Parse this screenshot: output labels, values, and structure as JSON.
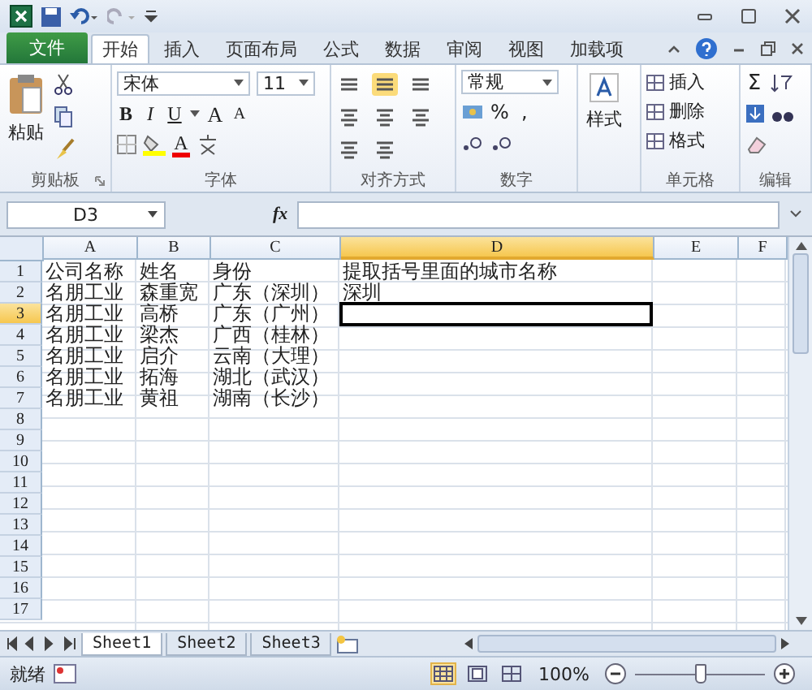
{
  "ribbon_tabs": [
    {
      "label": "文件",
      "kind": "file",
      "selected": false
    },
    {
      "label": "开始",
      "kind": "tab",
      "selected": true
    },
    {
      "label": "插入",
      "kind": "tab",
      "selected": false
    },
    {
      "label": "页面布局",
      "kind": "tab",
      "selected": false
    },
    {
      "label": "公式",
      "kind": "tab",
      "selected": false
    },
    {
      "label": "数据",
      "kind": "tab",
      "selected": false
    },
    {
      "label": "审阅",
      "kind": "tab",
      "selected": false
    },
    {
      "label": "视图",
      "kind": "tab",
      "selected": false
    },
    {
      "label": "加载项",
      "kind": "tab",
      "selected": false
    }
  ],
  "ribbon": {
    "clipboard": {
      "paste": "粘贴",
      "label": "剪贴板"
    },
    "font": {
      "name": "宋体",
      "size": "11",
      "bold": "B",
      "italic": "I",
      "underline": "U",
      "grow": "A",
      "shrink": "A",
      "color_button": "A",
      "label": "字体"
    },
    "alignment": {
      "label": "对齐方式"
    },
    "number": {
      "format": "常规",
      "percent": "%",
      "comma": ",",
      "label": "数字"
    },
    "styles": {
      "button": "样式"
    },
    "cells": {
      "items": [
        "插入",
        "删除",
        "格式"
      ],
      "label": "单元格"
    },
    "editing": {
      "sum": "Σ",
      "label": "编辑"
    }
  },
  "formula_bar": {
    "name_box": "D3",
    "fx": "fx"
  },
  "columns": [
    {
      "label": "A",
      "selected": false
    },
    {
      "label": "B",
      "selected": false
    },
    {
      "label": "C",
      "selected": false
    },
    {
      "label": "D",
      "selected": true
    },
    {
      "label": "E",
      "selected": false
    },
    {
      "label": "F",
      "selected": false
    }
  ],
  "rows": [
    {
      "number": "1",
      "selected": false,
      "cells": [
        "公司名称",
        "姓名",
        "身份",
        "提取括号里面的城市名称"
      ]
    },
    {
      "number": "2",
      "selected": false,
      "cells": [
        "名朋工业",
        "森重宽",
        "广东（深圳）",
        "深圳"
      ]
    },
    {
      "number": "3",
      "selected": true,
      "cells": [
        "名朋工业",
        "高桥",
        "广东（广州）"
      ]
    },
    {
      "number": "4",
      "selected": false,
      "cells": [
        "名朋工业",
        "梁杰",
        "广西（桂林）"
      ]
    },
    {
      "number": "5",
      "selected": false,
      "cells": [
        "名朋工业",
        "启介",
        "云南（大理）"
      ]
    },
    {
      "number": "6",
      "selected": false,
      "cells": [
        "名朋工业",
        "拓海",
        "湖北（武汉）"
      ]
    },
    {
      "number": "7",
      "selected": false,
      "cells": [
        "名朋工业",
        "黄祖",
        "湖南（长沙）"
      ]
    },
    {
      "number": "8",
      "selected": false
    },
    {
      "number": "9",
      "selected": false
    },
    {
      "number": "10",
      "selected": false
    },
    {
      "number": "11",
      "selected": false
    },
    {
      "number": "12",
      "selected": false
    },
    {
      "number": "13",
      "selected": false
    },
    {
      "number": "14",
      "selected": false
    },
    {
      "number": "15",
      "selected": false
    },
    {
      "number": "16",
      "selected": false
    },
    {
      "number": "17",
      "selected": false
    }
  ],
  "sheet_tabs": [
    {
      "label": "Sheet1",
      "selected": true
    },
    {
      "label": "Sheet2",
      "selected": false
    },
    {
      "label": "Sheet3",
      "selected": false
    }
  ],
  "status_bar": {
    "status": "就绪",
    "views": [
      {
        "kind": "normal",
        "selected": true
      },
      {
        "kind": "page_layout",
        "selected": false
      },
      {
        "kind": "page_break",
        "selected": false
      }
    ],
    "zoom": "100%",
    "zoom_slider": {
      "level": 0.5
    }
  }
}
